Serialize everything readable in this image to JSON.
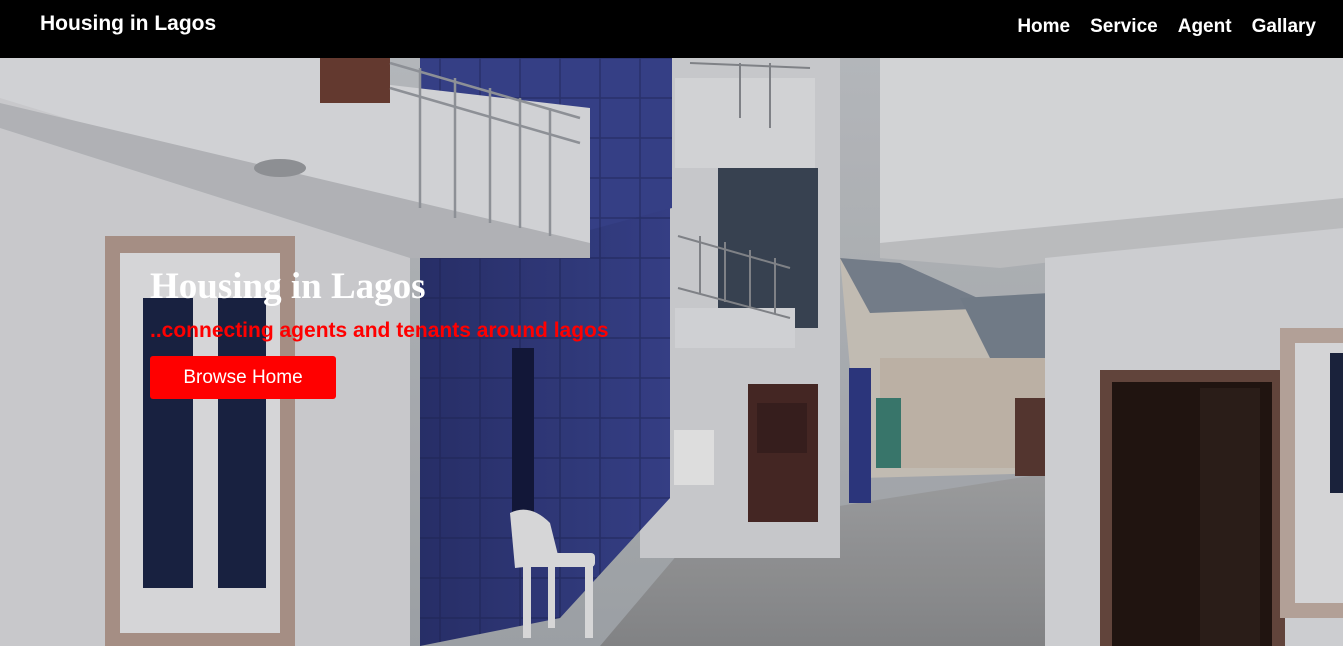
{
  "nav": {
    "brand": "Housing in Lagos",
    "links": [
      "Home",
      "Service",
      "Agent",
      "Gallary"
    ]
  },
  "hero": {
    "title": "Housing in Lagos",
    "tagline": "..connecting agents and tenants around lagos",
    "button_label": "Browse Home",
    "image": "housing-estate-photo"
  },
  "colors": {
    "navbar": "#000000",
    "accent": "#ff0000",
    "text": "#ffffff"
  }
}
